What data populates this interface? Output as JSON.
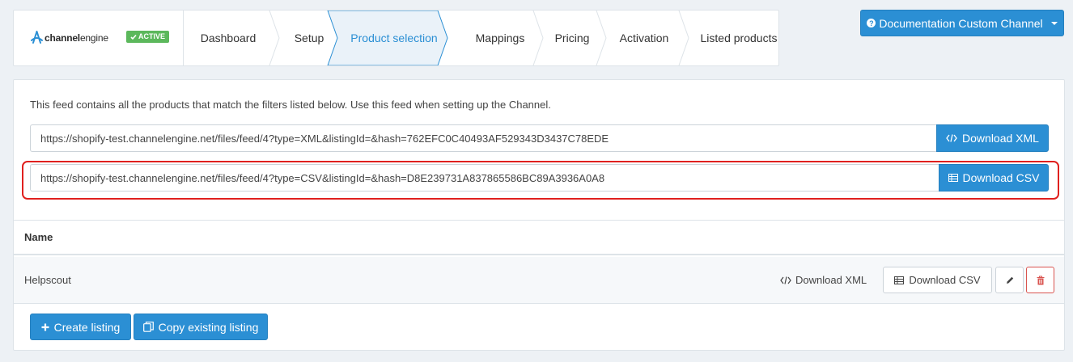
{
  "brand": {
    "logo_text_bold": "channel",
    "logo_text_rest": "engine",
    "status_badge": "ACTIVE"
  },
  "steps": [
    {
      "label": "Dashboard"
    },
    {
      "label": "Setup"
    },
    {
      "label": "Product selection",
      "active": true
    },
    {
      "label": "Mappings"
    },
    {
      "label": "Pricing"
    },
    {
      "label": "Activation"
    },
    {
      "label": "Listed products"
    }
  ],
  "documentation": {
    "label": "Documentation Custom Channel"
  },
  "feed": {
    "description": "This feed contains all the products that match the filters listed below. Use this feed when setting up the Channel.",
    "xml_url": "https://shopify-test.channelengine.net/files/feed/4?type=XML&listingId=&hash=762EFC0C40493AF529343D3437C78EDE",
    "xml_button": "Download XML",
    "csv_url": "https://shopify-test.channelengine.net/files/feed/4?type=CSV&listingId=&hash=D8E239731A837865586BC89A3936A0A8",
    "csv_button": "Download CSV"
  },
  "listings_table": {
    "header_name": "Name",
    "rows": [
      {
        "name": "Helpscout",
        "xml_label": "Download XML",
        "csv_label": "Download CSV"
      }
    ]
  },
  "actions": {
    "create_listing": "Create listing",
    "copy_listing": "Copy existing listing"
  },
  "colors": {
    "primary": "#2b8fd4",
    "active_badge": "#5cb85c",
    "highlight": "#e0201e",
    "danger": "#d9534f"
  }
}
